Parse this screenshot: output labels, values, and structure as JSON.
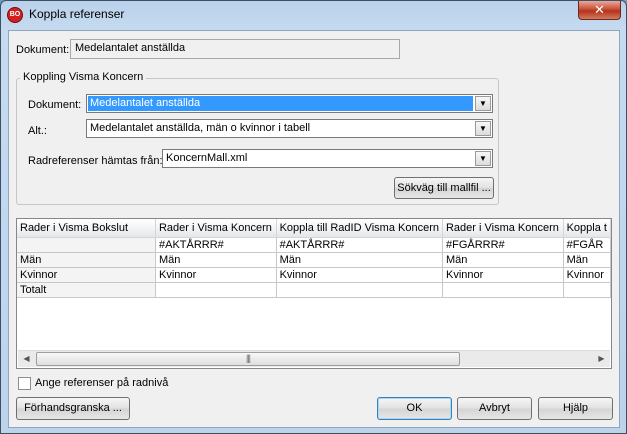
{
  "window": {
    "icon_text": "BO",
    "title": "Koppla referenser",
    "close_glyph": "✕"
  },
  "dokument": {
    "label": "Dokument:",
    "value": "Medelantalet anställda"
  },
  "group": {
    "title": "Koppling Visma Koncern",
    "dokument_label": "Dokument:",
    "dokument_value": "Medelantalet anställda",
    "alt_label": "Alt.:",
    "alt_value": "Medelantalet anställda, män o kvinnor i tabell",
    "rad_label": "Radreferenser hämtas från:",
    "rad_value": "KoncernMall.xml",
    "path_button": "Sökväg till mallfil ..."
  },
  "grid": {
    "columns": [
      "Rader i Visma Bokslut",
      "Rader i Visma Koncern",
      "Koppla till RadID Visma Koncern",
      "Rader i Visma Koncern",
      "Koppla t"
    ],
    "rows": [
      [
        "",
        "#AKTÅRRR#",
        "#AKTÅRRR#",
        "#FGÅRRR#",
        "#FGÅR"
      ],
      [
        "Män",
        "Män",
        "Män",
        "Män",
        "Män"
      ],
      [
        "Kvinnor",
        "Kvinnor",
        "Kvinnor",
        "Kvinnor",
        "Kvinnor"
      ],
      [
        "Totalt",
        "",
        "",
        "",
        ""
      ]
    ],
    "scroll_grip": "|||"
  },
  "checkbox": {
    "label": "Ange referenser på radnivå",
    "checked": false
  },
  "buttons": {
    "preview": "Förhandsgranska ...",
    "ok": "OK",
    "cancel": "Avbryt",
    "help": "Hjälp"
  },
  "colors": {
    "selection": "#3399ff",
    "close": "#c7503a",
    "dialog_bg": "#f0f0f0"
  }
}
